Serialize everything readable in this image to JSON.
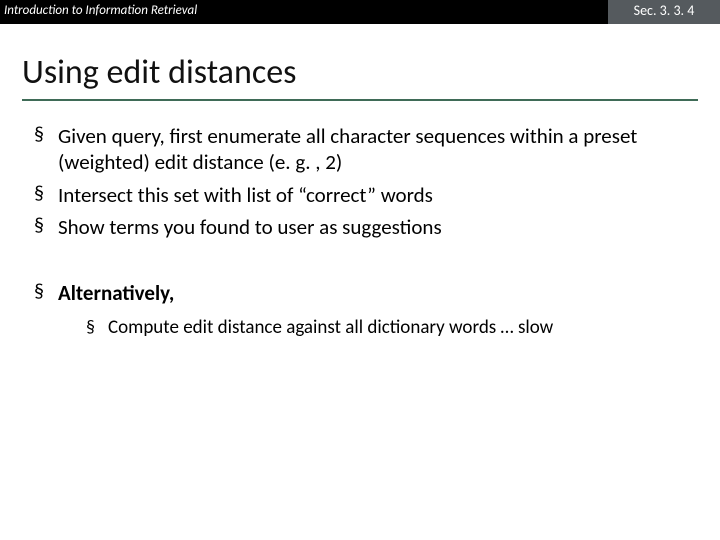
{
  "header": {
    "left": "Introduction to Information Retrieval",
    "right": "Sec. 3. 3. 4"
  },
  "title": "Using edit distances",
  "bullets": [
    "Given query, first enumerate all character sequences within a preset (weighted) edit distance (e. g. , 2)",
    "Intersect this set with list of “correct” words",
    "Show terms you found to user as suggestions"
  ],
  "alt_label": "Alternatively,",
  "alt_sub": [
    "Compute edit distance against all dictionary words … slow"
  ]
}
